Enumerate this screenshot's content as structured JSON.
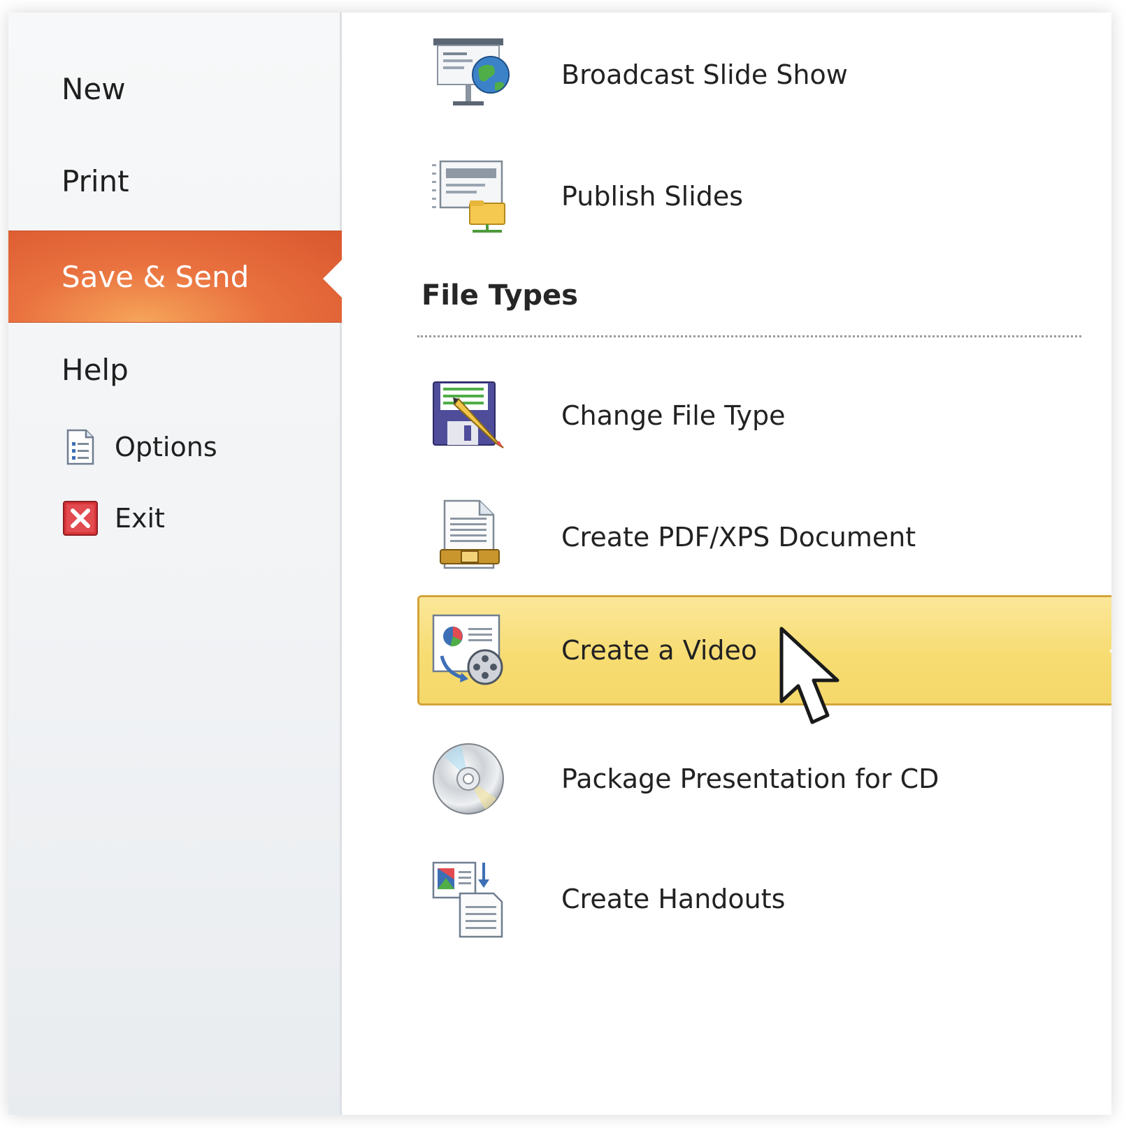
{
  "nav": {
    "new": "New",
    "print": "Print",
    "save_send": "Save & Send",
    "help": "Help",
    "options": "Options",
    "exit": "Exit"
  },
  "share_items": [
    {
      "label": "Broadcast Slide Show",
      "icon": "broadcast-slideshow-icon"
    },
    {
      "label": "Publish Slides",
      "icon": "publish-slides-icon"
    }
  ],
  "file_types": {
    "title": "File Types",
    "items": [
      {
        "label": "Change File Type",
        "icon": "save-floppy-pencil-icon"
      },
      {
        "label": "Create PDF/XPS Document",
        "icon": "pdf-document-icon"
      },
      {
        "label": "Create a Video",
        "icon": "video-reel-icon"
      },
      {
        "label": "Package Presentation for CD",
        "icon": "cd-disc-icon"
      },
      {
        "label": "Create Handouts",
        "icon": "handouts-icon"
      }
    ]
  },
  "colors": {
    "accent_orange": "#e9713f",
    "hover_yellow": "#f7dc72",
    "exit_red": "#d8343a"
  }
}
